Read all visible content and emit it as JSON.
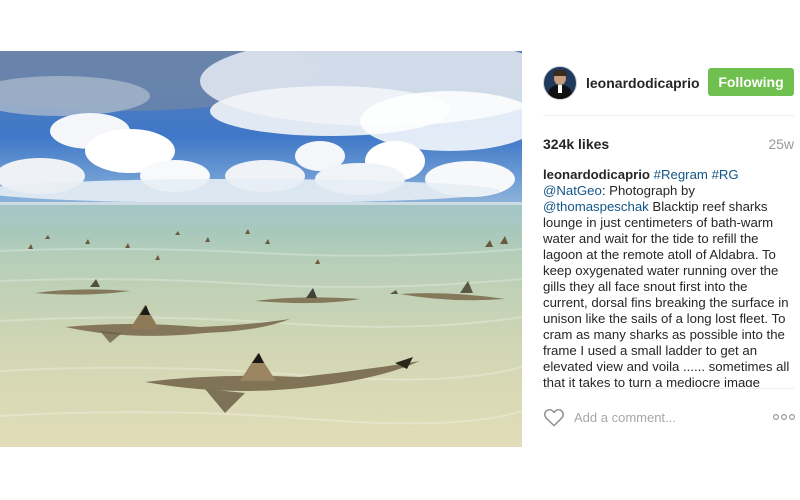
{
  "post": {
    "image_alt": "Blacktip reef sharks in shallow lagoon water",
    "username": "leonardodicaprio",
    "follow_label": "Following",
    "likes": "324k likes",
    "age": "25w",
    "caption": {
      "username": "leonardodicaprio",
      "hashtag1": "#Regram",
      "hashtag2": "#RG",
      "mention1": "@NatGeo",
      "text1": ": Photograph by ",
      "mention2": "@thomaspeschak",
      "text2": " Blacktip reef sharks lounge in just centimeters of bath-warm water and wait for the tide to refill the lagoon at the remote atoll of Aldabra. To keep oxygenated water running over the gills they all face snout first into the current, dorsal fins breaking the surface in unison like the sails of a long lost fleet. To cram as many sharks as possible into the frame I used a small ladder to get an elevated view and voila ...... sometimes all that it takes to turn a mediocre image"
    },
    "comment_placeholder": "Add a comment...",
    "icons": {
      "like": "heart-outline-icon",
      "more": "ellipsis-icon"
    },
    "colors": {
      "follow_button": "#70c050",
      "link": "#125688",
      "muted": "#999999"
    }
  }
}
